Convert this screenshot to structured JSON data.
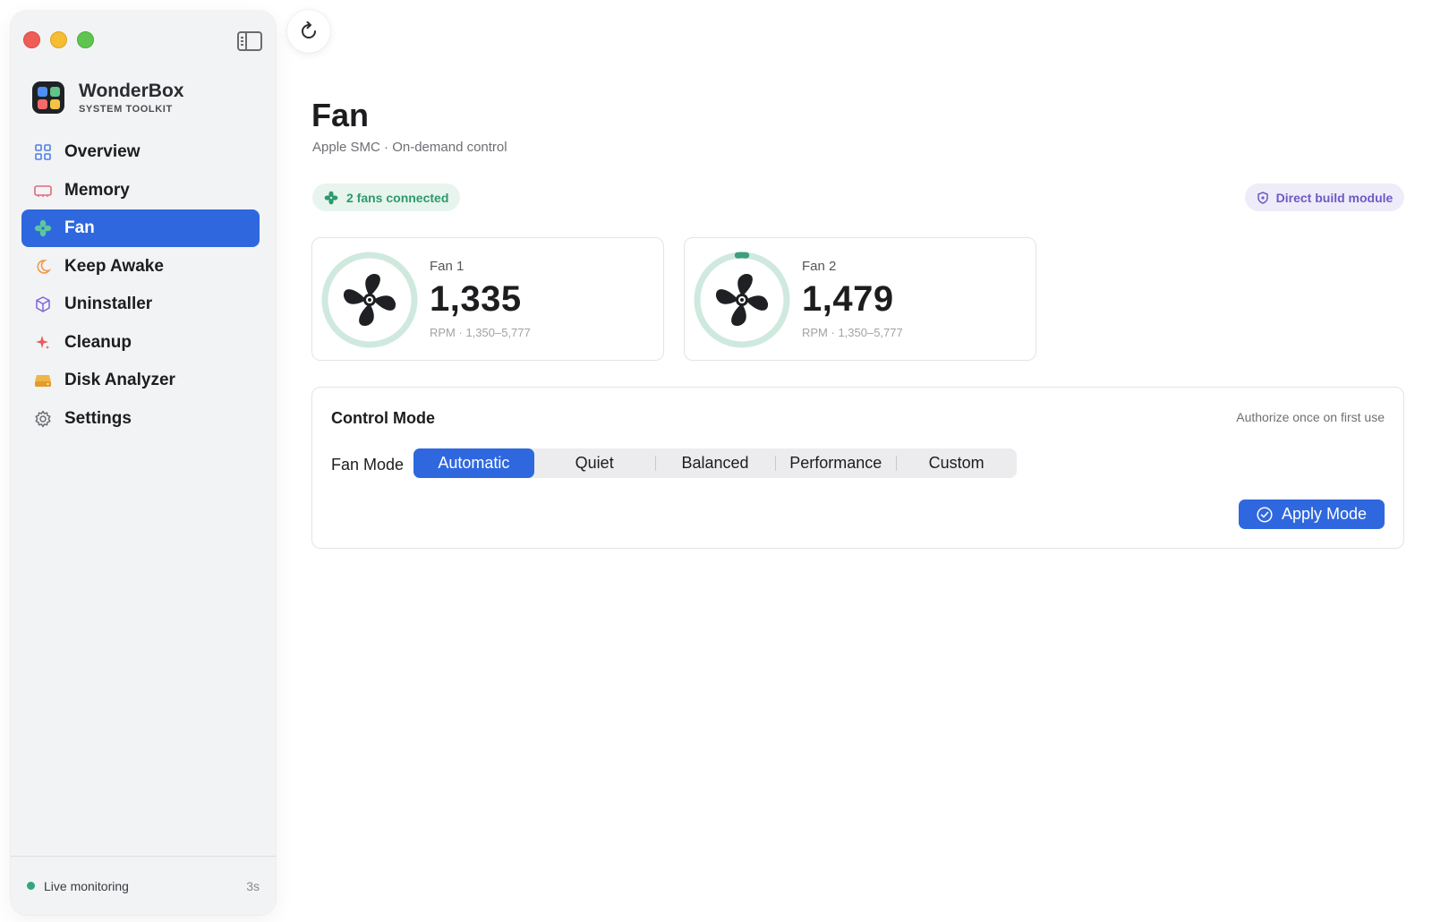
{
  "app": {
    "name": "WonderBox",
    "subtitle": "SYSTEM TOOLKIT"
  },
  "sidebar": {
    "items": [
      {
        "label": "Overview",
        "icon": "grid-icon",
        "active": false
      },
      {
        "label": "Memory",
        "icon": "memory-chip-icon",
        "active": false
      },
      {
        "label": "Fan",
        "icon": "fan-icon",
        "active": true
      },
      {
        "label": "Keep Awake",
        "icon": "moon-icon",
        "active": false
      },
      {
        "label": "Uninstaller",
        "icon": "box-icon",
        "active": false
      },
      {
        "label": "Cleanup",
        "icon": "sparkle-icon",
        "active": false
      },
      {
        "label": "Disk Analyzer",
        "icon": "disk-icon",
        "active": false
      },
      {
        "label": "Settings",
        "icon": "gear-icon",
        "active": false
      }
    ],
    "footer": {
      "status": "Live monitoring",
      "interval": "3s"
    }
  },
  "page": {
    "title": "Fan",
    "subtitle": "Apple SMC · On-demand control",
    "fans_badge": "2 fans connected",
    "build_badge": "Direct build module"
  },
  "fans": [
    {
      "name": "Fan 1",
      "rpm": "1,335",
      "range": "RPM · 1,350–5,777",
      "level": 0
    },
    {
      "name": "Fan 2",
      "rpm": "1,479",
      "range": "RPM · 1,350–5,777",
      "level": 0.03
    }
  ],
  "control": {
    "title": "Control Mode",
    "hint": "Authorize once on first use",
    "mode_label": "Fan Mode",
    "modes": [
      "Automatic",
      "Quiet",
      "Balanced",
      "Performance",
      "Custom"
    ],
    "selected": "Automatic",
    "apply_label": "Apply Mode"
  },
  "colors": {
    "accent": "#2f67de",
    "success": "#2c9a6c",
    "purple": "#6f58c9",
    "gauge_track": "#cfe9de",
    "gauge_fill": "#3f9e7a"
  }
}
